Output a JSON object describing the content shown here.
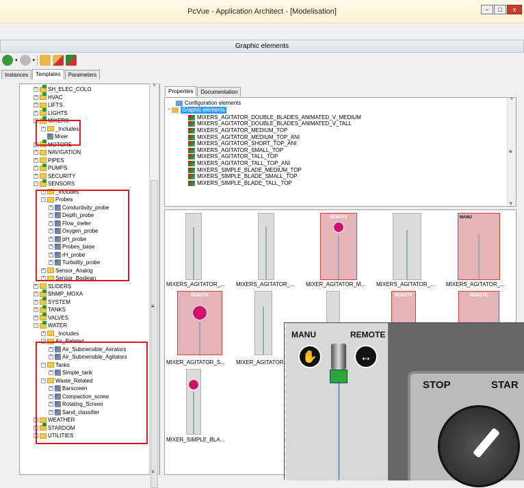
{
  "window": {
    "title": "PcVue - Application Architect - [Modelisation]",
    "minimize": "−",
    "maximize": "□",
    "close": "x"
  },
  "panel": {
    "header": "Graphic elements"
  },
  "left_tabs": [
    "Instances",
    "Templates",
    "Parameters"
  ],
  "tree": [
    {
      "label": "SH_ELEC_COLO",
      "indent": 0,
      "exp": "+",
      "type": "g"
    },
    {
      "label": "HVAC",
      "indent": 0,
      "exp": "+",
      "type": "g"
    },
    {
      "label": "LIFTS",
      "indent": 0,
      "exp": "+",
      "type": "f"
    },
    {
      "label": "LIGHTS",
      "indent": 0,
      "exp": "+",
      "type": "g"
    },
    {
      "label": "MIXERS",
      "indent": 0,
      "exp": "−",
      "type": "g"
    },
    {
      "label": "_Includes",
      "indent": 1,
      "exp": "+",
      "type": "f"
    },
    {
      "label": "Mixer",
      "indent": 1,
      "exp": "",
      "type": "i"
    },
    {
      "label": "MOTORS",
      "indent": 0,
      "exp": "+",
      "type": "g"
    },
    {
      "label": "NAVIGATION",
      "indent": 0,
      "exp": "+",
      "type": "f"
    },
    {
      "label": "PIPES",
      "indent": 0,
      "exp": "+",
      "type": "f"
    },
    {
      "label": "PUMPS",
      "indent": 0,
      "exp": "+",
      "type": "g"
    },
    {
      "label": "SECURITY",
      "indent": 0,
      "exp": "+",
      "type": "f"
    },
    {
      "label": "SENSORS",
      "indent": 0,
      "exp": "−",
      "type": "g"
    },
    {
      "label": "_Includes",
      "indent": 1,
      "exp": "+",
      "type": "f"
    },
    {
      "label": "Probes",
      "indent": 1,
      "exp": "−",
      "type": "f"
    },
    {
      "label": "Conductivity_probe",
      "indent": 2,
      "exp": "+",
      "type": "i"
    },
    {
      "label": "Depth_probe",
      "indent": 2,
      "exp": "+",
      "type": "i"
    },
    {
      "label": "Flow_meter",
      "indent": 2,
      "exp": "+",
      "type": "i"
    },
    {
      "label": "Oxygen_probe",
      "indent": 2,
      "exp": "+",
      "type": "i"
    },
    {
      "label": "pH_probe",
      "indent": 2,
      "exp": "+",
      "type": "i"
    },
    {
      "label": "Probes_base",
      "indent": 2,
      "exp": "+",
      "type": "i"
    },
    {
      "label": "rH_probe",
      "indent": 2,
      "exp": "+",
      "type": "i"
    },
    {
      "label": "Turbidity_probe",
      "indent": 2,
      "exp": "+",
      "type": "i"
    },
    {
      "label": "Sensor_Analog",
      "indent": 1,
      "exp": "+",
      "type": "f"
    },
    {
      "label": "Sensor_Boolean",
      "indent": 1,
      "exp": "+",
      "type": "f"
    },
    {
      "label": "SLIDERS",
      "indent": 0,
      "exp": "+",
      "type": "f"
    },
    {
      "label": "SNMP_MOXA",
      "indent": 0,
      "exp": "+",
      "type": "g"
    },
    {
      "label": "SYSTEM",
      "indent": 0,
      "exp": "+",
      "type": "g"
    },
    {
      "label": "TANKS",
      "indent": 0,
      "exp": "+",
      "type": "g"
    },
    {
      "label": "VALVES",
      "indent": 0,
      "exp": "+",
      "type": "g"
    },
    {
      "label": "WATER",
      "indent": 0,
      "exp": "−",
      "type": "g"
    },
    {
      "label": "_Includes",
      "indent": 1,
      "exp": "+",
      "type": "f"
    },
    {
      "label": "Air_Related",
      "indent": 1,
      "exp": "−",
      "type": "f"
    },
    {
      "label": "Air_Submersible_Aerators",
      "indent": 2,
      "exp": "+",
      "type": "i"
    },
    {
      "label": "Air_Submersible_Agitators",
      "indent": 2,
      "exp": "+",
      "type": "i"
    },
    {
      "label": "Tanks",
      "indent": 1,
      "exp": "−",
      "type": "f"
    },
    {
      "label": "Simple_tank",
      "indent": 2,
      "exp": "+",
      "type": "i"
    },
    {
      "label": "Waste_Related",
      "indent": 1,
      "exp": "−",
      "type": "f"
    },
    {
      "label": "Barscreen",
      "indent": 2,
      "exp": "+",
      "type": "i"
    },
    {
      "label": "Compaction_screw",
      "indent": 2,
      "exp": "+",
      "type": "i"
    },
    {
      "label": "Rotating_Screen",
      "indent": 2,
      "exp": "+",
      "type": "i"
    },
    {
      "label": "Sand_classifier",
      "indent": 2,
      "exp": "+",
      "type": "i"
    },
    {
      "label": "WEATHER",
      "indent": 0,
      "exp": "+",
      "type": "f"
    },
    {
      "label": "STARDOM",
      "indent": 0,
      "exp": "+",
      "type": "g"
    },
    {
      "label": "UTILITIES",
      "indent": 0,
      "exp": "+",
      "type": "f"
    }
  ],
  "right_tabs": [
    "Properties",
    "Documentation"
  ],
  "props": {
    "config": "Configuration elements",
    "graphic": "Graphic elements",
    "items": [
      "MIXERS_AGITATOR_DOUBLE_BLADES_ANIMATED_V_MEDIUM",
      "MIXERS_AGITATOR_DOUBLE_BLADES_ANIMATED_V_TALL",
      "MIXERS_AGITATOR_MEDIUM_TOP",
      "MIXERS_AGITATOR_MEDIUM_TOP_ANI",
      "MIXERS_AGITATOR_SHORT_TOP_ANI",
      "MIXERS_AGITATOR_SMALL_TOP",
      "MIXERS_AGITATOR_TALL_TOP",
      "MIXERS_AGITATOR_TALL_TOP_ANI",
      "MIXERS_SIMPLE_BLADE_MEDIUM_TOP",
      "MIXERS_SIMPLE_BLADE_SMALL_TOP",
      "MIXERS_SIMPLE_BLADE_TALL_TOP"
    ]
  },
  "thumbs": {
    "row1": [
      "MIXERS_AGITATOR_...",
      "MIXERS_AGITATOR_...",
      "MIXER_AGITATOR_M...",
      "MIXERS_AGITATOR_...",
      "MIXERS_AGITATOR_..."
    ],
    "row2": [
      "MIXER_AGITATOR_S...",
      "MIXER_AGITATOR"
    ],
    "row3": [
      "MIXER_SIMPLE_BLA..."
    ],
    "remote": "REMOTE",
    "manu": "MANU"
  },
  "zoom": {
    "manu": "MANU",
    "remote": "REMOTE",
    "stop": "STOP",
    "start": "STAR"
  }
}
